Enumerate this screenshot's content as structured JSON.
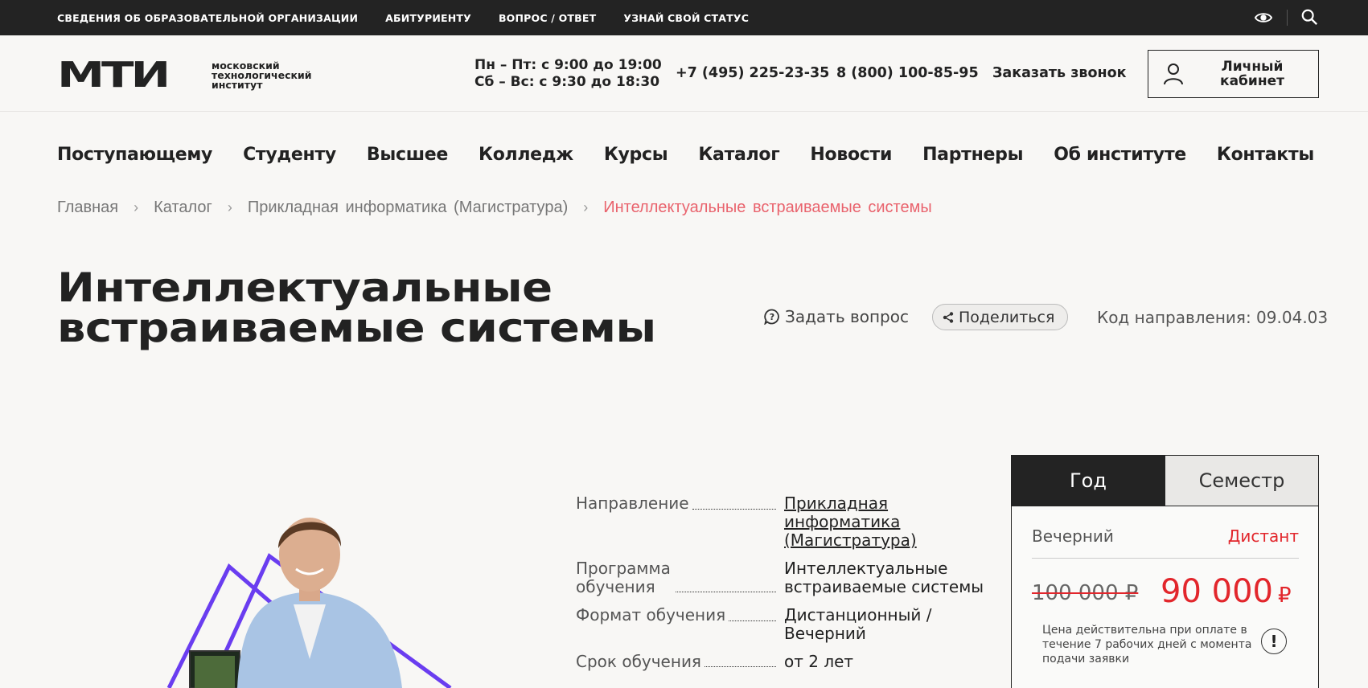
{
  "topbar": {
    "links": [
      "СВЕДЕНИЯ ОБ ОБРАЗОВАТЕЛЬНОЙ ОРГАНИЗАЦИИ",
      "АБИТУРИЕНТУ",
      "ВОПРОС / ОТВЕТ",
      "УЗНАЙ СВОЙ СТАТУС"
    ],
    "icons": [
      "eye-icon",
      "search-icon"
    ]
  },
  "header": {
    "logo_mark": "МТИ",
    "logo_name_1": "московский",
    "logo_name_2": "технологический",
    "logo_name_3": "институт",
    "hours_1": "Пн – Пт: с 9:00 до 19:00",
    "hours_2": "Сб – Вс: с 9:30 до 18:30",
    "phone_1": "+7 (495) 225-23-35",
    "phone_2": "8 (800) 100-85-95",
    "callback": "Заказать звонок",
    "cabinet_1": "Личный",
    "cabinet_2": "кабинет"
  },
  "nav": [
    "Поступающему",
    "Студенту",
    "Высшее",
    "Колледж",
    "Курсы",
    "Каталог",
    "Новости",
    "Партнеры",
    "Об институте",
    "Контакты"
  ],
  "breadcrumb": {
    "items": [
      "Главная",
      "Каталог",
      "Прикладная информатика (Магистратура)"
    ],
    "current": "Интеллектуальные встраиваемые системы",
    "separator": "›"
  },
  "page": {
    "title_1": "Интеллектуальные",
    "title_2": "встраиваемые системы",
    "ask": "Задать вопрос",
    "share": "Поделиться",
    "code": "Код направления: 09.04.03"
  },
  "details": [
    {
      "key": "Направление",
      "value": "Прикладная информатика (Магистратура)",
      "link": true
    },
    {
      "key": "Программа обучения",
      "value": "Интеллектуальные встраиваемые системы",
      "link": false
    },
    {
      "key": "Формат обучения",
      "value": "Дистанционный / Вечерний",
      "link": false
    },
    {
      "key": "Срок обучения",
      "value": "от 2 лет",
      "link": false
    }
  ],
  "price": {
    "tab_year": "Год",
    "tab_semester": "Семестр",
    "mode_evening": "Вечерний",
    "mode_distant": "Дистант",
    "old": "100 000 ₽",
    "new": "90 000",
    "currency": "₽",
    "note": "Цена действительна при оплате в течение 7 рабочих дней с момента подачи заявки",
    "warn": "!"
  },
  "colors": {
    "accent": "#e2262c",
    "breadcrumb_current": "#e9636d",
    "dark": "#232323",
    "triangle": "#6a3df0"
  }
}
